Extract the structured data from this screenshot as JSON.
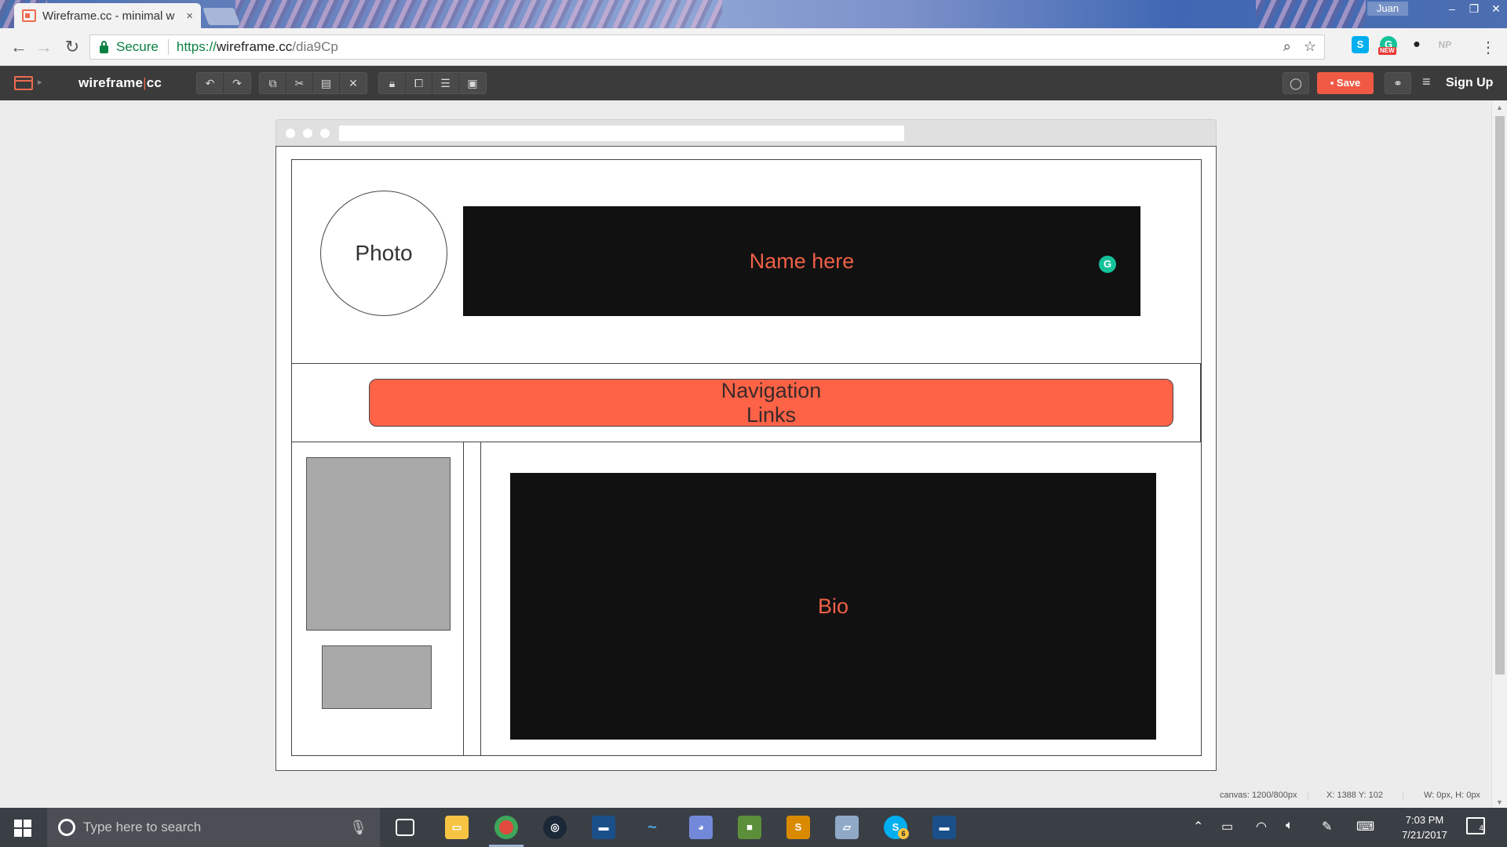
{
  "browser": {
    "tab_title": "Wireframe.cc - minimal w",
    "tab_close": "×",
    "profile_name": "Juan",
    "secure_label": "Secure",
    "url_proto": "https://",
    "url_host": "wireframe.cc",
    "url_path": "/dia9Cp",
    "ext_new_badge": "NEW",
    "ext_np": "NP"
  },
  "app": {
    "brand_left": "wireframe",
    "brand_sep": "|",
    "brand_right": "cc",
    "save_label": "Save",
    "signup_label": "Sign Up",
    "accent_color": "#f05a45"
  },
  "wireframe": {
    "photo_label": "Photo",
    "name_label": "Name here",
    "nav_line1": "Navigation",
    "nav_line2": "Links",
    "bio_label": "Bio",
    "nav_fill_color": "#ff6347",
    "text_color": "#ef6048"
  },
  "status": {
    "canvas": "canvas: 1200/800px",
    "cursor": "X: 1388 Y: 102",
    "size": "W: 0px, H: 0px"
  },
  "taskbar": {
    "search_placeholder": "Type here to search",
    "skype_badge": "6",
    "time": "7:03 PM",
    "date": "7/21/2017",
    "notif_count": "4"
  }
}
